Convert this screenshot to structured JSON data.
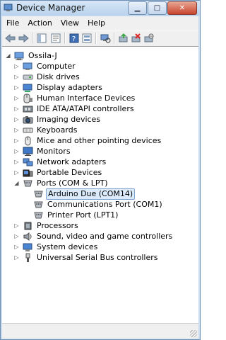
{
  "window": {
    "title": "Device Manager"
  },
  "menu": [
    {
      "label": "File",
      "name": "menu-file"
    },
    {
      "label": "Action",
      "name": "menu-action"
    },
    {
      "label": "View",
      "name": "menu-view"
    },
    {
      "label": "Help",
      "name": "menu-help"
    }
  ],
  "toolbar_icons": [
    "back-arrow-icon",
    "forward-arrow-icon",
    "console-tree-icon",
    "properties-icon",
    "help-icon",
    "view-icon",
    "scan-hardware-icon",
    "update-driver-icon",
    "uninstall-icon",
    "disable-device-icon"
  ],
  "tree": {
    "root": "Ossila-J",
    "categories": [
      {
        "label": "Computer",
        "icon": "computer-icon"
      },
      {
        "label": "Disk drives",
        "icon": "disk-drive-icon"
      },
      {
        "label": "Display adapters",
        "icon": "display-adapter-icon"
      },
      {
        "label": "Human Interface Devices",
        "icon": "hid-icon"
      },
      {
        "label": "IDE ATA/ATAPI controllers",
        "icon": "ide-controller-icon"
      },
      {
        "label": "Imaging devices",
        "icon": "camera-icon"
      },
      {
        "label": "Keyboards",
        "icon": "keyboard-icon"
      },
      {
        "label": "Mice and other pointing devices",
        "icon": "mouse-icon"
      },
      {
        "label": "Monitors",
        "icon": "monitor-icon"
      },
      {
        "label": "Network adapters",
        "icon": "network-adapter-icon"
      },
      {
        "label": "Portable Devices",
        "icon": "portable-device-icon"
      },
      {
        "label": "Ports (COM & LPT)",
        "icon": "port-icon",
        "expanded": true,
        "children": [
          "Arduino Due (COM14)",
          "Communications Port (COM1)",
          "Printer Port (LPT1)"
        ]
      },
      {
        "label": "Processors",
        "icon": "processor-icon"
      },
      {
        "label": "Sound, video and game controllers",
        "icon": "speaker-icon"
      },
      {
        "label": "System devices",
        "icon": "system-device-icon"
      },
      {
        "label": "Universal Serial Bus controllers",
        "icon": "usb-icon"
      }
    ]
  }
}
